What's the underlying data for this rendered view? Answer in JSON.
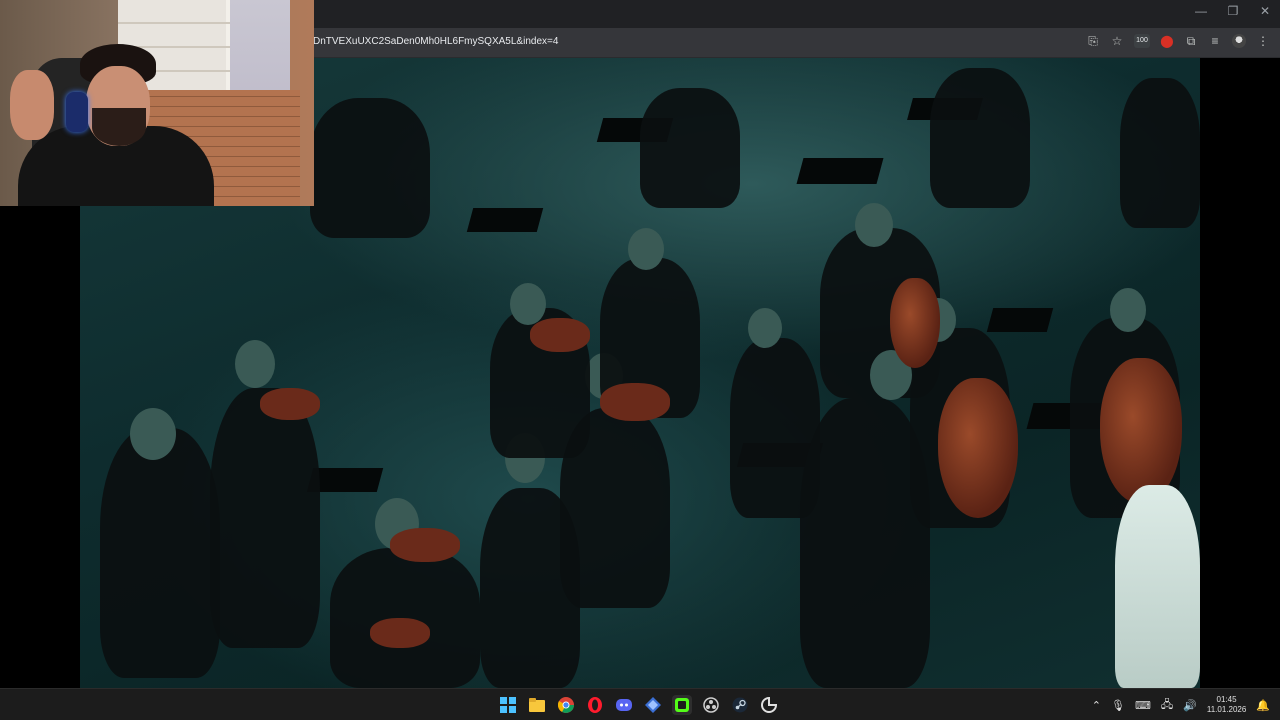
{
  "browser": {
    "url": "DnTVEXuUXC2SaDen0Mh0HL6FmySQXA5L&index=4",
    "extension_badge": "100",
    "window_controls": [
      "—",
      "❐",
      "✕"
    ]
  },
  "colors": {
    "video_tint": "#16393a",
    "taskbar": "#1c1c1c",
    "browser_toolbar": "#35363a"
  },
  "icons": {
    "toolbar": [
      "share-icon",
      "star-icon",
      "extension-100-icon",
      "record-icon",
      "extensions-icon",
      "media-icon",
      "profile-avatar-icon",
      "menu-icon"
    ],
    "taskbar": [
      "windows-start-icon",
      "file-explorer-icon",
      "chrome-icon",
      "opera-icon",
      "discord-icon",
      "network-app-icon",
      "streaming-app-icon",
      "obs-icon",
      "steam-icon",
      "app-icon"
    ]
  },
  "taskbar": {
    "time": "01:45",
    "date": "11.01.2026"
  }
}
